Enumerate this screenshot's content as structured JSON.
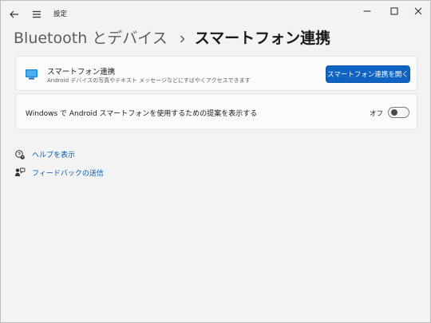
{
  "window": {
    "title": "設定",
    "icons": {
      "back": "back-arrow-icon",
      "menu": "hamburger-menu-icon",
      "minimize": "minimize-icon",
      "maximize": "maximize-icon",
      "close": "close-icon"
    }
  },
  "breadcrumb": {
    "parent": "Bluetooth とデバイス",
    "separator_icon": "chevron-right-icon",
    "current": "スマートフォン連携"
  },
  "phone_link_card": {
    "icon": "phone-link-icon",
    "title": "スマートフォン連携",
    "description": "Android デバイスの写真やテキスト メッセージなどにすばやくアクセスできます",
    "button_label": "スマートフォン連携を開く"
  },
  "suggestion_card": {
    "text": "Windows で Android スマートフォンを使用するための提案を表示する",
    "toggle_state_label": "オフ",
    "toggle_on": false
  },
  "help_links": [
    {
      "icon": "help-icon",
      "label": "ヘルプを表示"
    },
    {
      "icon": "feedback-icon",
      "label": "フィードバックの送信"
    }
  ],
  "colors": {
    "accent": "#0f63c2",
    "link": "#0b5cad",
    "background": "#f3f3f3",
    "card": "#fbfbfb"
  }
}
